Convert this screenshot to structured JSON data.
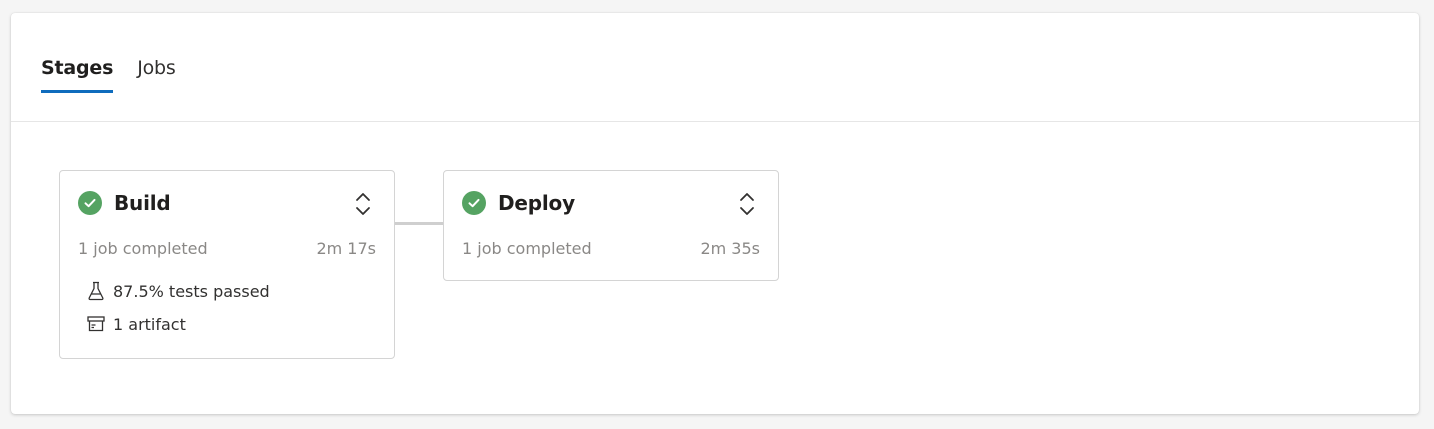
{
  "tabs": [
    {
      "label": "Stages",
      "selected": true
    },
    {
      "label": "Jobs",
      "selected": false
    }
  ],
  "stages": [
    {
      "name": "Build",
      "status": "succeeded",
      "status_icon": "check-circle-icon",
      "summary": "1 job completed",
      "duration": "2m 17s",
      "tests": "87.5% tests passed",
      "artifacts": "1 artifact"
    },
    {
      "name": "Deploy",
      "status": "succeeded",
      "status_icon": "check-circle-icon",
      "summary": "1 job completed",
      "duration": "2m 35s"
    }
  ],
  "colors": {
    "accent": "#0f6cbd",
    "success": "#55a362"
  }
}
